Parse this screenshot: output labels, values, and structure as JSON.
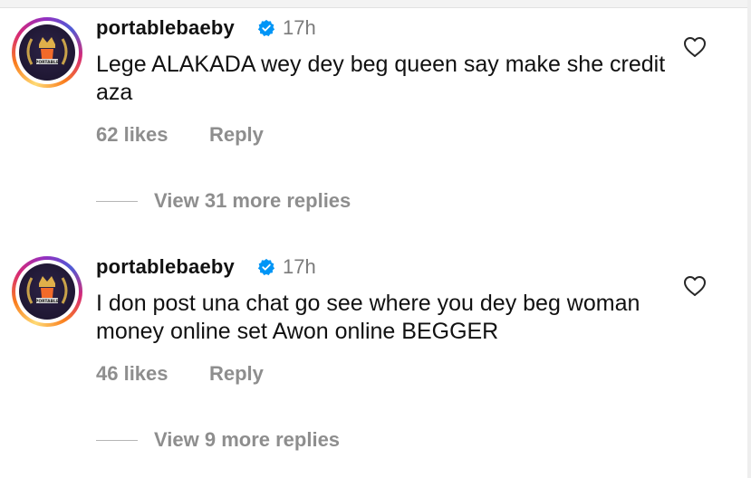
{
  "comments": [
    {
      "username": "portablebaeby",
      "time": "17h",
      "text": "Lege ALAKADA wey dey beg queen say make she credit aza",
      "likes": "62 likes",
      "reply_label": "Reply",
      "view_replies": "View 31 more replies",
      "verified": true,
      "liked": false
    },
    {
      "username": "portablebaeby",
      "time": "17h",
      "text": "I don post una chat go see where you dey beg woman money online set Awon online BEGGER",
      "likes": "46 likes",
      "reply_label": "Reply",
      "view_replies": "View 9 more replies",
      "verified": true,
      "liked": false
    }
  ],
  "avatar": {
    "badge_text": "PORTABLE"
  },
  "icons": {
    "verified": "verified-badge-icon",
    "like": "heart-outline-icon"
  },
  "colors": {
    "verified_blue": "#0095f6",
    "muted_text": "#8e8e8e",
    "timestamp": "#7b7b7b",
    "primary_text": "#111111"
  }
}
